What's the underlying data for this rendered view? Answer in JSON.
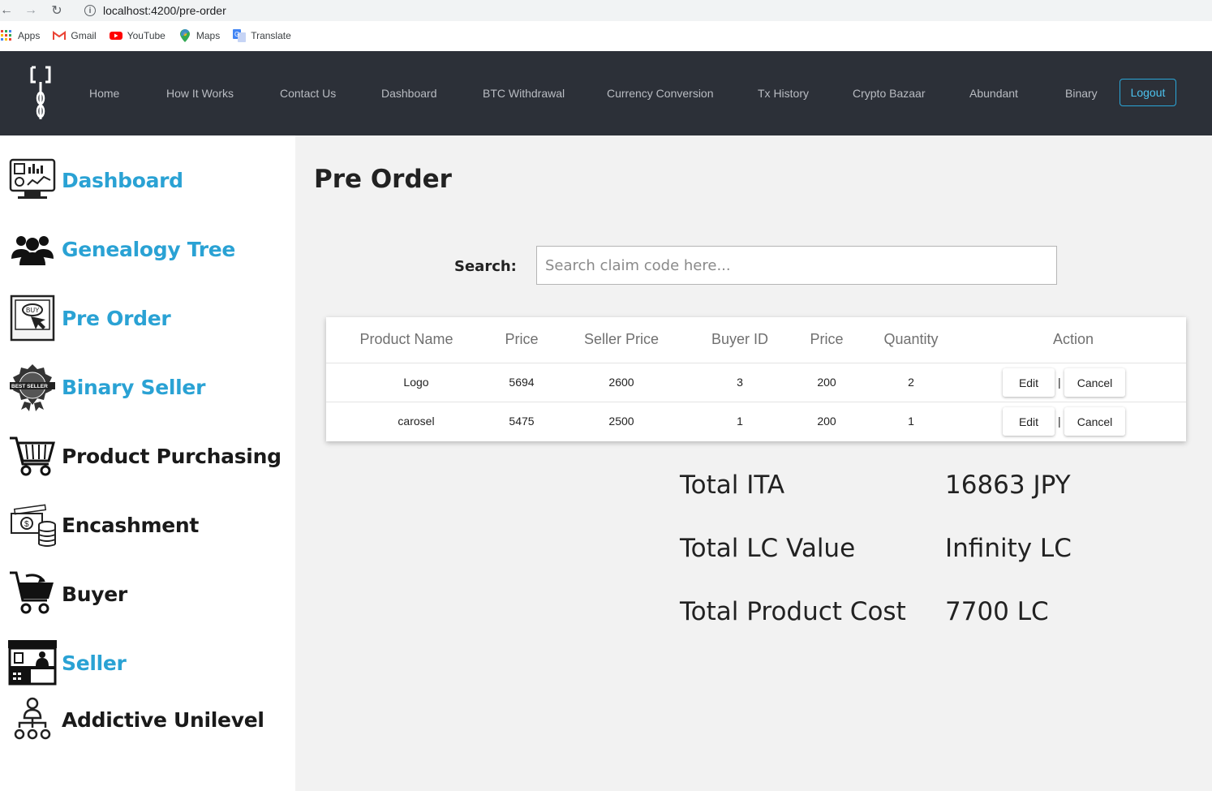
{
  "browser": {
    "url": "localhost:4200/pre-order",
    "bookmarks": [
      "Apps",
      "Gmail",
      "YouTube",
      "Maps",
      "Translate"
    ]
  },
  "navbar": {
    "links": [
      "Home",
      "How It Works",
      "Contact Us",
      "Dashboard",
      "BTC Withdrawal",
      "Currency Conversion",
      "Tx History",
      "Crypto Bazaar",
      "Abundant",
      "Binary"
    ],
    "logout_label": "Logout"
  },
  "sidebar": {
    "items": [
      {
        "label": "Dashboard",
        "icon": "dashboard-icon",
        "color": "#2aa2d4"
      },
      {
        "label": "Genealogy Tree",
        "icon": "group-icon",
        "color": "#2aa2d4"
      },
      {
        "label": "Pre Order",
        "icon": "buy-icon",
        "color": "#2aa2d4"
      },
      {
        "label": "Binary Seller",
        "icon": "best-seller-badge-icon",
        "color": "#2aa2d4"
      },
      {
        "label": "Product Purchasing",
        "icon": "shopping-cart-icon",
        "color": "#1a1a1a"
      },
      {
        "label": "Encashment",
        "icon": "money-icon",
        "color": "#1a1a1a"
      },
      {
        "label": "Buyer",
        "icon": "cart-arrow-icon",
        "color": "#1a1a1a"
      },
      {
        "label": "Seller",
        "icon": "shop-stall-icon",
        "color": "#2aa2d4"
      },
      {
        "label": "Addictive Unilevel",
        "icon": "hierarchy-icon",
        "color": "#1a1a1a"
      }
    ]
  },
  "main": {
    "title": "Pre Order",
    "search": {
      "label": "Search:",
      "placeholder": "Search claim code here...",
      "value": ""
    },
    "table": {
      "headers": [
        "Product Name",
        "Price",
        "Seller Price",
        "Buyer ID",
        "Price",
        "Quantity",
        "Action"
      ],
      "rows": [
        {
          "product_name": "Logo",
          "price": "5694",
          "seller_price": "2600",
          "buyer_id": "3",
          "price2": "200",
          "quantity": "2"
        },
        {
          "product_name": "carosel",
          "price": "5475",
          "seller_price": "2500",
          "buyer_id": "1",
          "price2": "200",
          "quantity": "1"
        }
      ],
      "edit_label": "Edit",
      "separator": "|",
      "cancel_label": "Cancel"
    },
    "summary": [
      {
        "label": "Total ITA",
        "value": "16863 JPY"
      },
      {
        "label": "Total LC Value",
        "value": "Infinity LC"
      },
      {
        "label": "Total Product Cost",
        "value": "7700 LC"
      }
    ]
  },
  "colors": {
    "navbar_bg": "#2c3038",
    "accent": "#2aa2d4",
    "main_bg": "#f2f2f2"
  }
}
